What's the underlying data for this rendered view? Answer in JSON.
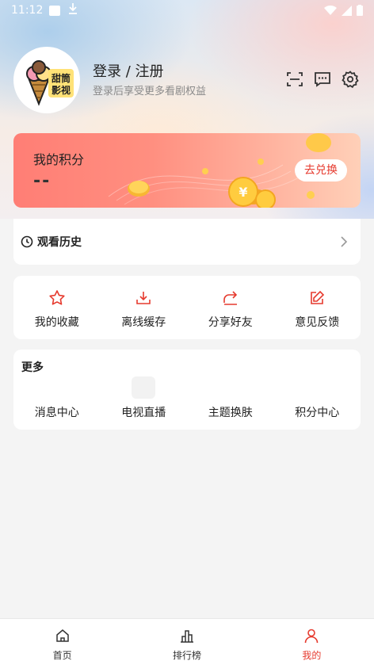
{
  "status_bar": {
    "time": "11:12"
  },
  "profile": {
    "title": "登录 / 注册",
    "subtitle": "登录后享受更多看剧权益",
    "avatar_text_1": "甜筒",
    "avatar_text_2": "影视"
  },
  "points": {
    "title": "我的积分",
    "value": "--",
    "button_label": "去兑换"
  },
  "history": {
    "label": "观看历史"
  },
  "actions": [
    {
      "label": "我的收藏",
      "icon": "star-icon"
    },
    {
      "label": "离线缓存",
      "icon": "download-icon"
    },
    {
      "label": "分享好友",
      "icon": "share-icon"
    },
    {
      "label": "意见反馈",
      "icon": "edit-icon"
    }
  ],
  "more": {
    "title": "更多",
    "items": [
      {
        "label": "消息中心"
      },
      {
        "label": "电视直播"
      },
      {
        "label": "主题换肤"
      },
      {
        "label": "积分中心"
      }
    ]
  },
  "bottom_nav": [
    {
      "label": "首页",
      "icon": "home-icon",
      "active": false
    },
    {
      "label": "排行榜",
      "icon": "ranking-icon",
      "active": false
    },
    {
      "label": "我的",
      "icon": "user-icon",
      "active": true
    }
  ],
  "colors": {
    "accent": "#e63a2e",
    "points_gradient_start": "#ff7e75",
    "points_gradient_end": "#ffd0b8"
  }
}
